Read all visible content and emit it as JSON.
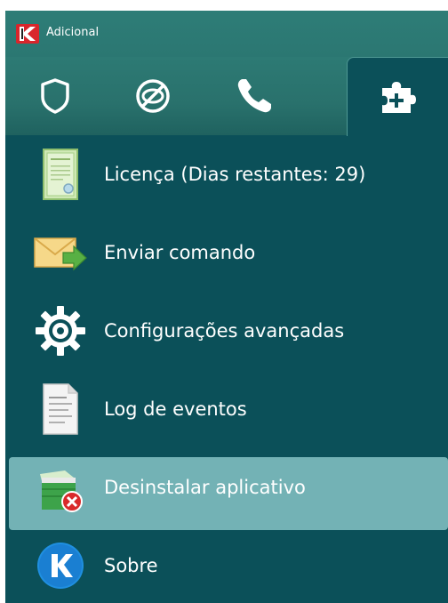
{
  "window": {
    "title": "Adicional"
  },
  "tabs": [
    {
      "icon": "shield-icon"
    },
    {
      "icon": "blocked-icon"
    },
    {
      "icon": "phone-icon"
    },
    {
      "icon": "puzzle-plus-icon",
      "active": true
    }
  ],
  "menu": {
    "items": [
      {
        "label": "Licença (Dias restantes: 29)",
        "icon": "license-certificate-icon"
      },
      {
        "label": "Enviar comando",
        "icon": "envelope-arrow-icon"
      },
      {
        "label": "Configurações avançadas",
        "icon": "gear-icon"
      },
      {
        "label": "Log de eventos",
        "icon": "document-log-icon"
      },
      {
        "label": "Desinstalar aplicativo",
        "icon": "uninstall-box-icon",
        "selected": true
      },
      {
        "label": "Sobre",
        "icon": "kaspersky-k-icon"
      }
    ]
  },
  "colors": {
    "panel": "#0b5059",
    "tabbar": "#2b7772",
    "selection": "#73b2b5",
    "text": "#ffffff"
  }
}
